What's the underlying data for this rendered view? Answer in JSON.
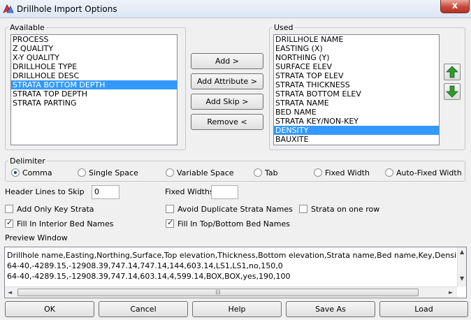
{
  "window": {
    "title": "Drillhole Import Options",
    "close_label": "x"
  },
  "available": {
    "legend": "Available",
    "items": [
      "PROCESS",
      "Z QUALITY",
      "X-Y QUALITY",
      "DRILLHOLE TYPE",
      "DRILLHOLE DESC",
      "STRATA BOTTOM DEPTH",
      "STRATA TOP DEPTH",
      "STRATA PARTING"
    ],
    "selected_index": 5
  },
  "used": {
    "legend": "Used",
    "items": [
      "DRILLHOLE NAME",
      "EASTING (X)",
      "NORTHING (Y)",
      "SURFACE ELEV",
      "STRATA TOP ELEV",
      "STRATA THICKNESS",
      "STRATA BOTTOM ELEV",
      "STRATA NAME",
      "BED NAME",
      "STRATA KEY/NON-KEY",
      "DENSITY",
      "BAUXITE"
    ],
    "selected_index": 10
  },
  "middle_buttons": {
    "add": "Add >",
    "add_attribute": "Add Attribute >",
    "add_skip": "Add Skip >",
    "remove": "Remove <"
  },
  "delimiter": {
    "legend": "Delimiter",
    "options": [
      "Comma",
      "Single Space",
      "Variable Space",
      "Tab",
      "Fixed Width",
      "Auto-Fixed Width"
    ],
    "selected": "Comma"
  },
  "header_lines": {
    "label": "Header Lines to Skip",
    "value": "0"
  },
  "fixed_widths": {
    "label": "Fixed Widths",
    "value": ""
  },
  "checkboxes": {
    "add_only_key_strata": {
      "label": "Add Only Key Strata",
      "checked": false
    },
    "avoid_duplicate": {
      "label": "Avoid Duplicate Strata Names",
      "checked": false
    },
    "strata_one_row": {
      "label": "Strata on one row",
      "checked": false
    },
    "fill_interior": {
      "label": "Fill In Interior Bed Names",
      "checked": true
    },
    "fill_top_bottom": {
      "label": "Fill In Top/Bottom Bed Names",
      "checked": true
    }
  },
  "preview": {
    "label": "Preview Window",
    "lines": [
      "Drillhole name,Easting,Northing,Surface,Top elevation,Thickness,Bottom elevation,Strata name,Bed name,Key,Densi",
      "64-40,-4289.15,-12908.39,747.14,747.14,144,603.14,LS1,LS1,no,150,0",
      "64-40,-4289.15,-12908.39,747.14,603.14,4,599.14,BOX,BOX,yes,190,100"
    ],
    "scroll_grip": "|||"
  },
  "bottom_buttons": {
    "ok": "OK",
    "cancel": "Cancel",
    "help": "Help",
    "save_as": "Save As",
    "load": "Load"
  },
  "colors": {
    "selection": "#3399ff",
    "arrow_green": "#2e9a2e"
  }
}
